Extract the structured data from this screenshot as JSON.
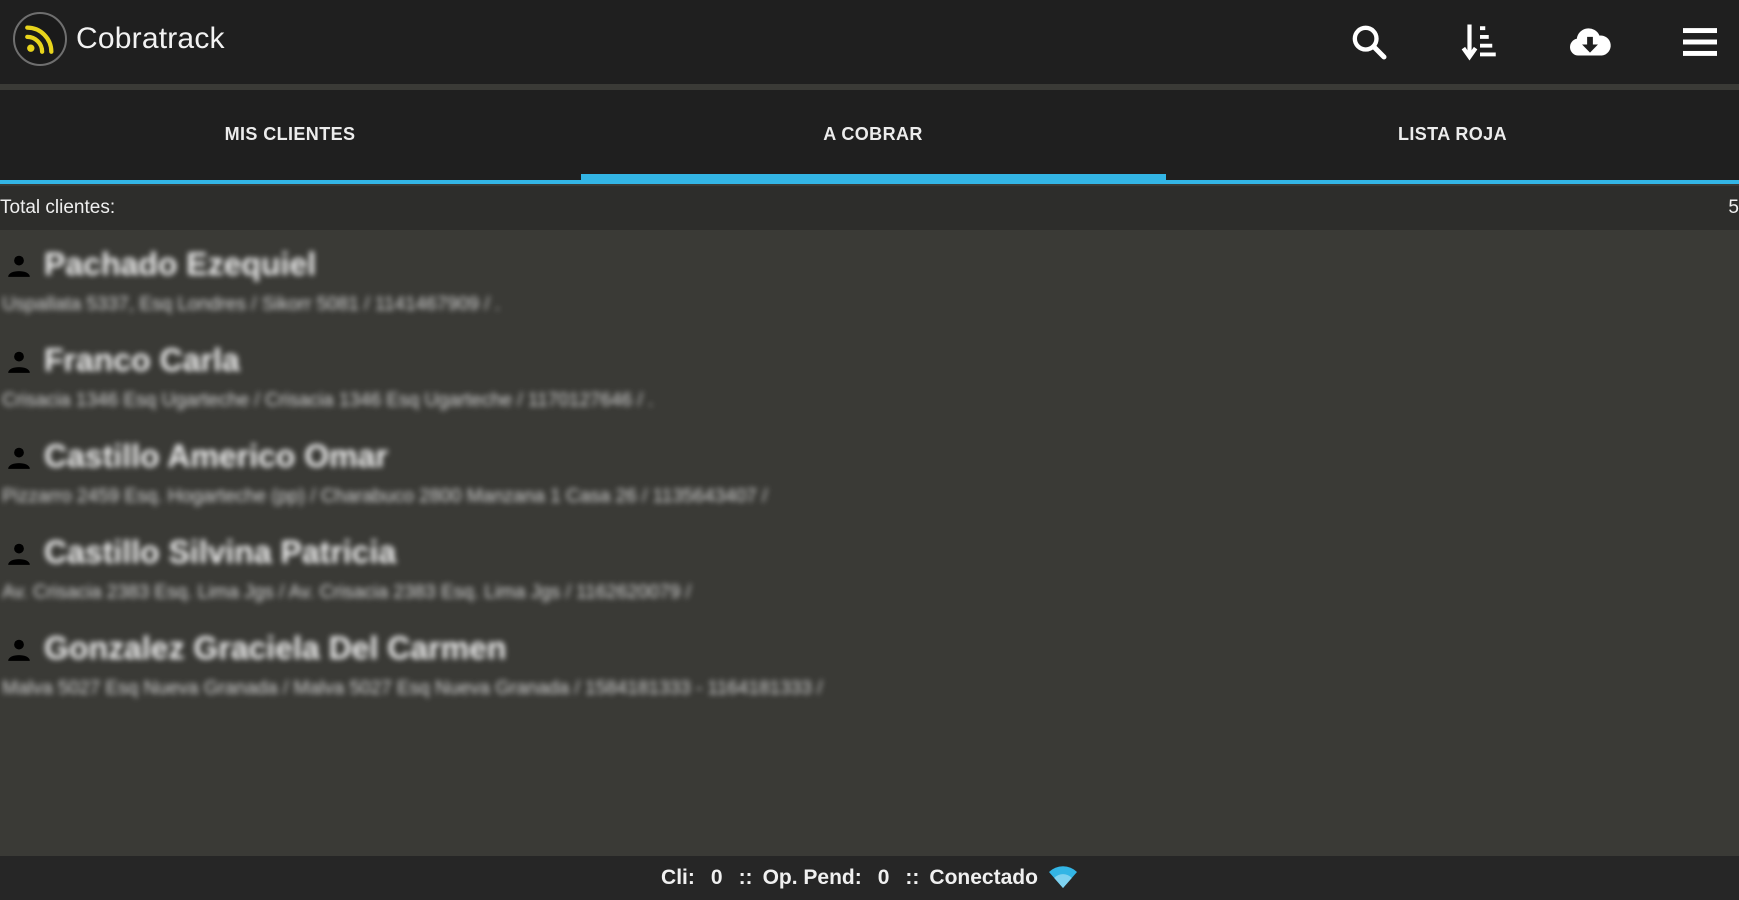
{
  "app": {
    "title": "Cobratrack",
    "icons": {
      "logo": "rss-feed-icon",
      "search": "search-icon",
      "sort": "sort-descending-icon",
      "download": "cloud-download-icon",
      "menu": "hamburger-menu-icon"
    }
  },
  "colors": {
    "accent": "#33b5e5",
    "logo_yellow": "#e8d41c",
    "bar_bg": "#1f1f1f",
    "content_bg": "#3a3a36"
  },
  "tabs": [
    {
      "label": "MIS CLIENTES",
      "selected": false
    },
    {
      "label": "A COBRAR",
      "selected": true
    },
    {
      "label": "LISTA ROJA",
      "selected": false
    }
  ],
  "summary": {
    "total_label": "Total clientes:",
    "total_value": "5"
  },
  "clients": [
    {
      "name": "Pachado Ezequiel",
      "detail": "Uspallata 5337, Esq Londres / Sikorr 5081 / 1141467909 / ."
    },
    {
      "name": "Franco Carla",
      "detail": "Crisacia 1346 Esq Ugarteche / Crisacia 1346 Esq Ugarteche / 1170127646 / ."
    },
    {
      "name": "Castillo Americo Omar",
      "detail": "Pizzarro 2459 Esq. Hogarteche (pp) / Charabuco 2800 Manzana 1 Casa 26 / 1135643407 /"
    },
    {
      "name": "Castillo Silvina Patricia",
      "detail": "Av. Crisacia 2383 Esq. Lima Jgs / Av. Crisacia 2383 Esq. Lima Jgs / 1162620079 /"
    },
    {
      "name": "Gonzalez Graciela Del Carmen",
      "detail": "Malva 5027 Esq Nueva Granada / Malva 5027 Esq Nueva Granada / 1584181333 - 1164181333 /"
    }
  ],
  "status": {
    "cli_label": "Cli:",
    "cli_value": "0",
    "separator": "::",
    "op_label": "Op. Pend:",
    "op_value": "0",
    "connection": "Conectado",
    "connection_icon": "wifi-signal-icon"
  }
}
